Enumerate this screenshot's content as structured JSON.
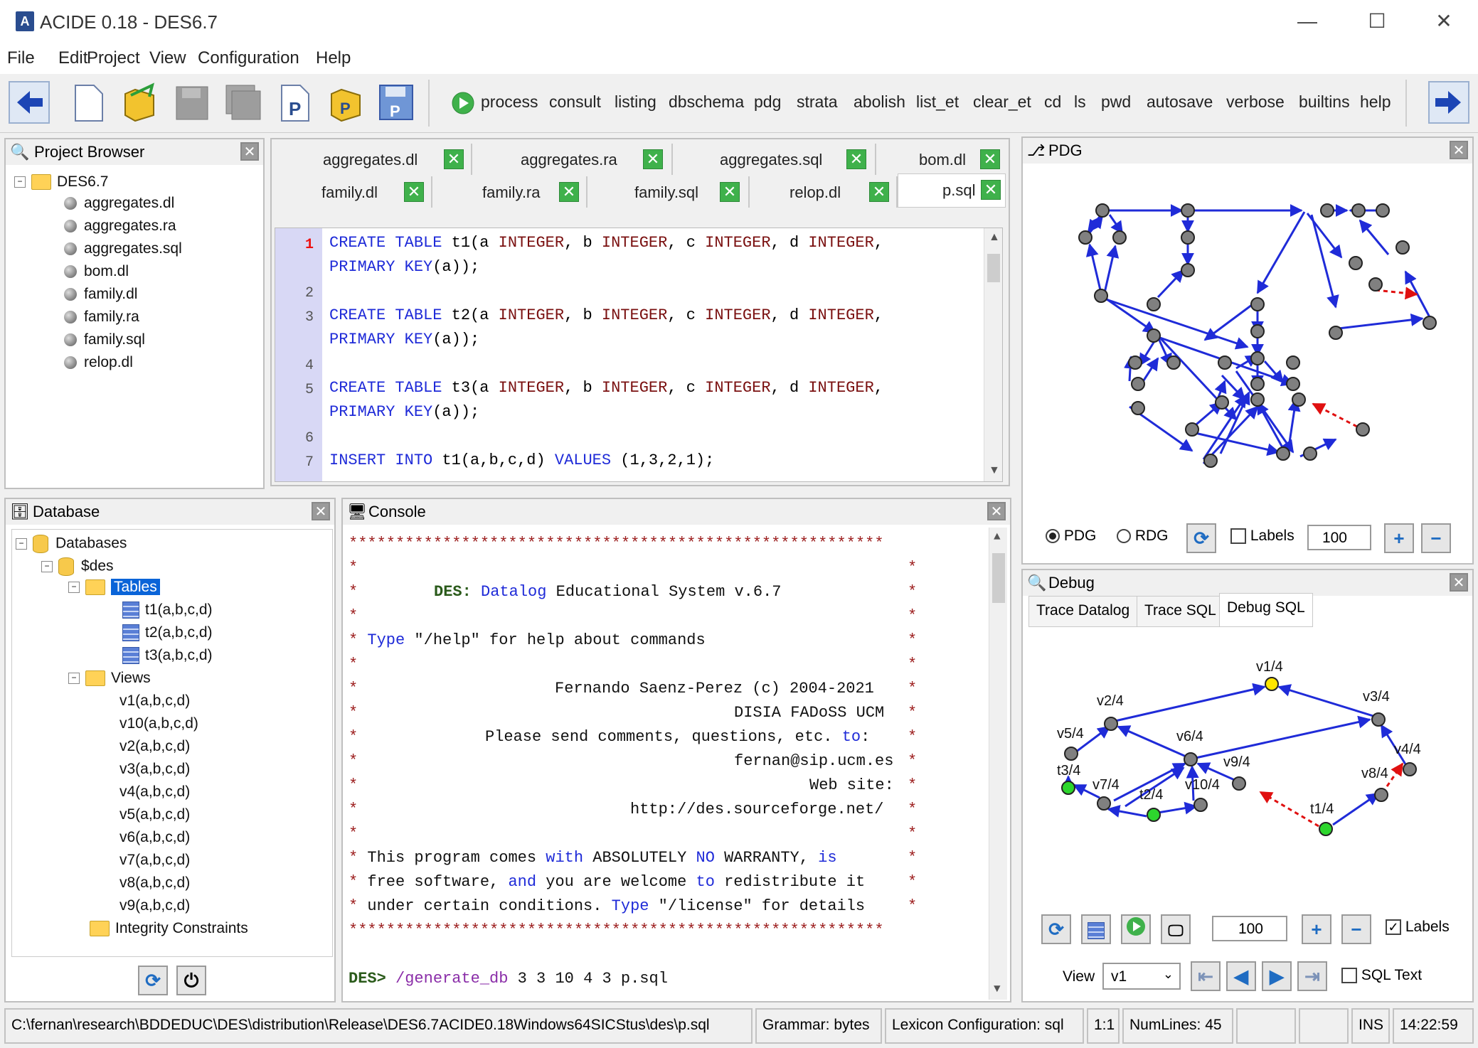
{
  "window": {
    "title": "ACIDE 0.18 - DES6.7",
    "minimize": "—",
    "maximize": "☐",
    "close": "✕"
  },
  "menu": [
    "File",
    "Edit",
    "Project",
    "View",
    "Configuration",
    "Help"
  ],
  "toolbar": {
    "commands": [
      "process",
      "consult",
      "listing",
      "dbschema",
      "pdg",
      "strata",
      "abolish",
      "list_et",
      "clear_et",
      "cd",
      "ls",
      "pwd",
      "autosave",
      "verbose",
      "builtins",
      "help"
    ]
  },
  "project_browser": {
    "title": "Project Browser",
    "root": "DES6.7",
    "files": [
      "aggregates.dl",
      "aggregates.ra",
      "aggregates.sql",
      "bom.dl",
      "family.dl",
      "family.ra",
      "family.sql",
      "relop.dl"
    ]
  },
  "editor": {
    "tabs_row1": [
      "aggregates.dl",
      "aggregates.ra",
      "aggregates.sql",
      "bom.dl"
    ],
    "tabs_row2": [
      "family.dl",
      "family.ra",
      "family.sql",
      "relop.dl",
      "p.sql"
    ],
    "line_numbers": [
      "1",
      "2",
      "3",
      "4",
      "5",
      "6",
      "7"
    ],
    "t1": "t1(a ",
    "t2": "t2(a ",
    "t3": "t3(a ",
    "kw_create": "CREATE",
    "kw_table": "TABLE",
    "kw_integer": "INTEGER",
    "b": ", b ",
    "c": ", c ",
    "d": ", d ",
    "comma": ",",
    "kw_primary": "PRIMARY",
    "kw_key": "KEY",
    "pk_tail": "(a));",
    "insert_kw1": "INSERT",
    "insert_kw2": "INTO",
    "insert_mid": " t1(a,b,c,d) ",
    "insert_kw3": "VALUES",
    "insert_tail": " (1,3,2,1);"
  },
  "pdg_panel": {
    "title": "PDG",
    "radio_pdg": "PDG",
    "radio_rdg": "RDG",
    "labels": "Labels",
    "zoom": "100"
  },
  "database": {
    "title": "Database",
    "root": "Databases",
    "db": "$des",
    "tables_label": "Tables",
    "tables": [
      "t1(a,b,c,d)",
      "t2(a,b,c,d)",
      "t3(a,b,c,d)"
    ],
    "views_label": "Views",
    "views": [
      "v1(a,b,c,d)",
      "v10(a,b,c,d)",
      "v2(a,b,c,d)",
      "v3(a,b,c,d)",
      "v4(a,b,c,d)",
      "v5(a,b,c,d)",
      "v6(a,b,c,d)",
      "v7(a,b,c,d)",
      "v8(a,b,c,d)",
      "v9(a,b,c,d)"
    ],
    "constraints": "Integrity Constraints"
  },
  "console": {
    "title": "Console",
    "stars": "*********************************************************",
    "star_edge": "*",
    "des": "DES:",
    "datalog": "Datalog",
    "educational": " Educational System v.6.7",
    "type_kw": "Type",
    "help_line": " \"/help\" for help about commands",
    "author": "Fernando Saenz-Perez (c) 2004-2021",
    "org": "DISIA FADoSS UCM",
    "send": "Please send comments, questions, etc. ",
    "to": "to",
    "email": "fernan@sip.ucm.es",
    "web": "Web site:",
    "url": "http://des.sourceforge.net/",
    "w1a": "This program comes ",
    "w1b": "with",
    "w1c": " ABSOLUTELY ",
    "w1d": "NO",
    "w1e": " WARRANTY, ",
    "w1f": "is",
    "w2a": "free software, ",
    "w2b": "and",
    "w2c": " you are welcome ",
    "w2d": "to",
    "w2e": " redistribute it",
    "w3a": "under certain conditions. ",
    "w3b": "Type",
    "w3c": " \"/license\" for details",
    "prompt": "DES>",
    "cmd": "/generate_db",
    "args": " 3 3 10 4 3 p.sql"
  },
  "debug": {
    "title": "Debug",
    "tabs": [
      "Trace Datalog",
      "Trace SQL",
      "Debug SQL"
    ],
    "active_tab": "Debug SQL",
    "nodes": [
      "v1/4",
      "v2/4",
      "v3/4",
      "v4/4",
      "v5/4",
      "v6/4",
      "v7/4",
      "v8/4",
      "v9/4",
      "v10/4",
      "t1/4",
      "t2/4",
      "t3/4"
    ],
    "zoom": "100",
    "labels": "Labels",
    "view_label": "View",
    "view_value": "v1",
    "sql_text": "SQL Text"
  },
  "statusbar": {
    "path": "C:\\fernan\\research\\BDDEDUC\\DES\\distribution\\Release\\DES6.7ACIDE0.18Windows64SICStus\\des\\p.sql",
    "grammar": "Grammar: bytes",
    "lexicon": "Lexicon Configuration: sql",
    "position": "1:1",
    "numlines": "NumLines: 45",
    "mode": "INS",
    "time": "14:22:59"
  }
}
